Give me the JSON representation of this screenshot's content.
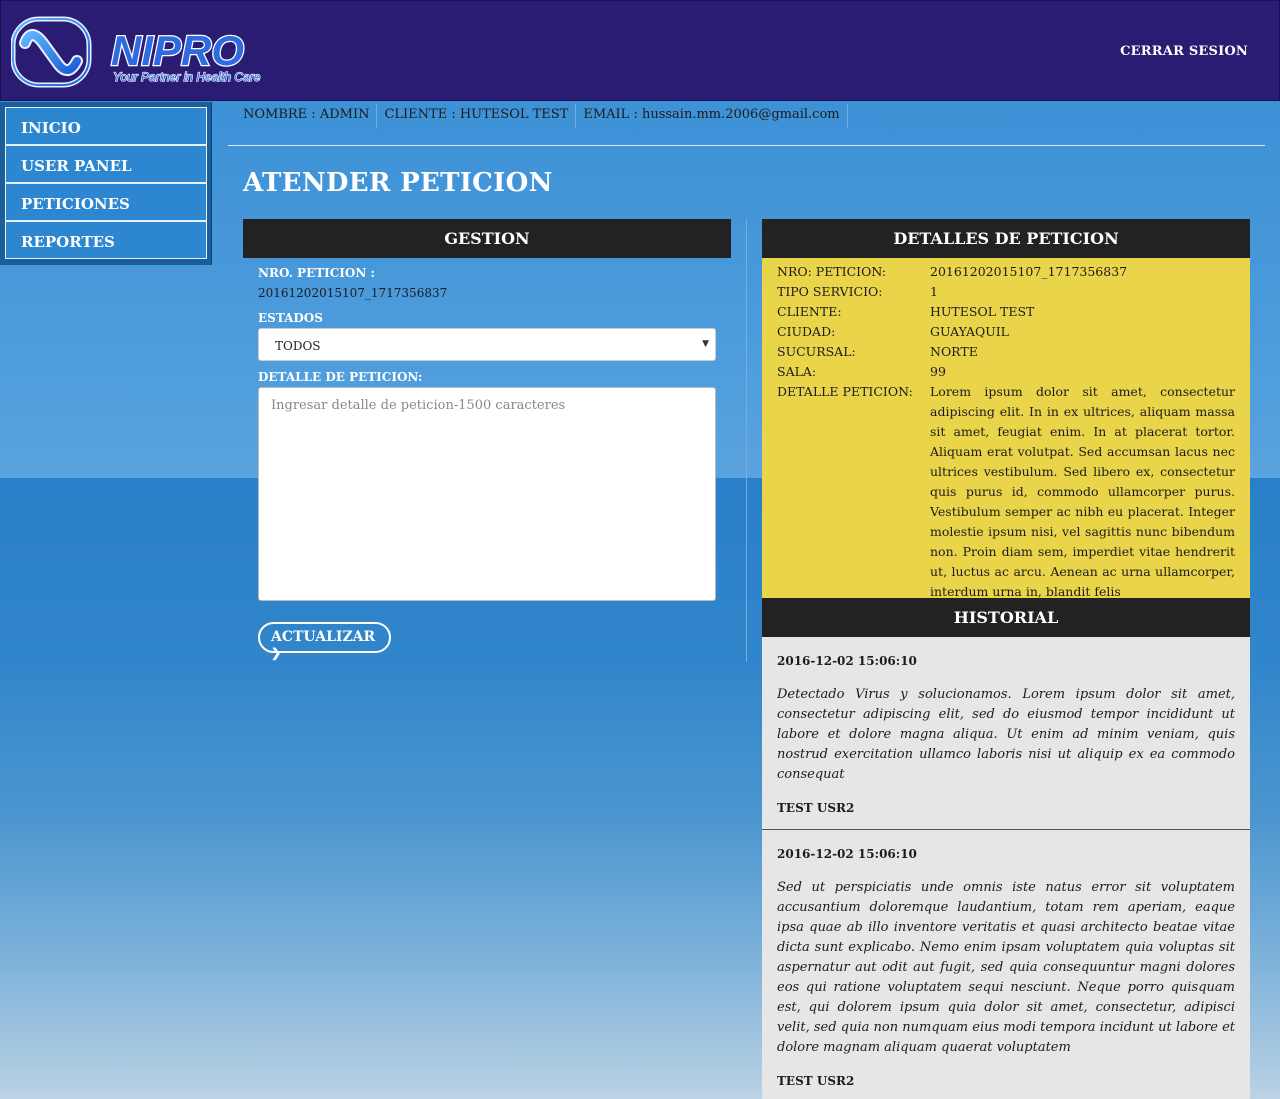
{
  "brand": {
    "name": "NIPRO",
    "tagline": "Your Partner in Health Care"
  },
  "header": {
    "logout": "CERRAR SESION"
  },
  "sidebar": {
    "items": [
      {
        "label": "INICIO"
      },
      {
        "label": "USER PANEL"
      },
      {
        "label": "PETICIONES"
      },
      {
        "label": "REPORTES"
      }
    ]
  },
  "userbar": {
    "nombre": "NOMBRE : ADMIN",
    "cliente": "CLIENTE : HUTESOL TEST",
    "email": "EMAIL : hussain.mm.2006@gmail.com"
  },
  "page": {
    "title": "ATENDER PETICION"
  },
  "gestion": {
    "title": "GESTION",
    "nro_label": "NRO. PETICION :",
    "nro_value": "20161202015107_1717356837",
    "estados_label": "ESTADOS",
    "estados_selected": "TODOS",
    "detalle_label": "DETALLE DE PETICION:",
    "detalle_placeholder": "Ingresar detalle de peticion-1500 caracteres",
    "button": "ACTUALIZAR"
  },
  "detalles": {
    "title": "DETALLES DE PETICION",
    "fields": [
      {
        "k": "NRO: PETICION:",
        "v": "20161202015107_1717356837"
      },
      {
        "k": "TIPO SERVICIO:",
        "v": "1"
      },
      {
        "k": "CLIENTE:",
        "v": "HUTESOL TEST"
      },
      {
        "k": "CIUDAD:",
        "v": "GUAYAQUIL"
      },
      {
        "k": "SUCURSAL:",
        "v": "NORTE"
      },
      {
        "k": "SALA:",
        "v": "99"
      },
      {
        "k": "DETALLE PETICION:",
        "v": "Lorem ipsum dolor sit amet, consectetur adipiscing elit. In in ex ultrices, aliquam massa sit amet, feugiat enim. In at placerat tortor. Aliquam erat volutpat. Sed accumsan lacus nec ultrices vestibulum. Sed libero ex, consectetur quis purus id, commodo ullamcorper purus. Vestibulum semper ac nibh eu placerat. Integer molestie ipsum nisi, vel sagittis nunc bibendum non. Proin diam sem, imperdiet vitae hendrerit ut, luctus ac arcu. Aenean ac urna ullamcorper, interdum urna in, blandit felis"
      }
    ]
  },
  "historial": {
    "title": "HISTORIAL",
    "entries": [
      {
        "date": "2016-12-02 15:06:10",
        "text": "Detectado Virus y solucionamos. Lorem ipsum dolor sit amet, consectetur adipiscing elit, sed do eiusmod tempor incididunt ut labore et dolore magna aliqua. Ut enim ad minim veniam, quis nostrud exercitation ullamco laboris nisi ut aliquip ex ea commodo consequat",
        "user": "TEST USR2"
      },
      {
        "date": "2016-12-02 15:06:10",
        "text": "Sed ut perspiciatis unde omnis iste natus error sit voluptatem accusantium doloremque laudantium, totam rem aperiam, eaque ipsa quae ab illo inventore veritatis et quasi architecto beatae vitae dicta sunt explicabo. Nemo enim ipsam voluptatem quia voluptas sit aspernatur aut odit aut fugit, sed quia consequuntur magni dolores eos qui ratione voluptatem sequi nesciunt. Neque porro quisquam est, qui dolorem ipsum quia dolor sit amet, consectetur, adipisci velit, sed quia non numquam eius modi tempora incidunt ut labore et dolore magnam aliquam quaerat voluptatem",
        "user": "TEST USR2"
      }
    ]
  }
}
